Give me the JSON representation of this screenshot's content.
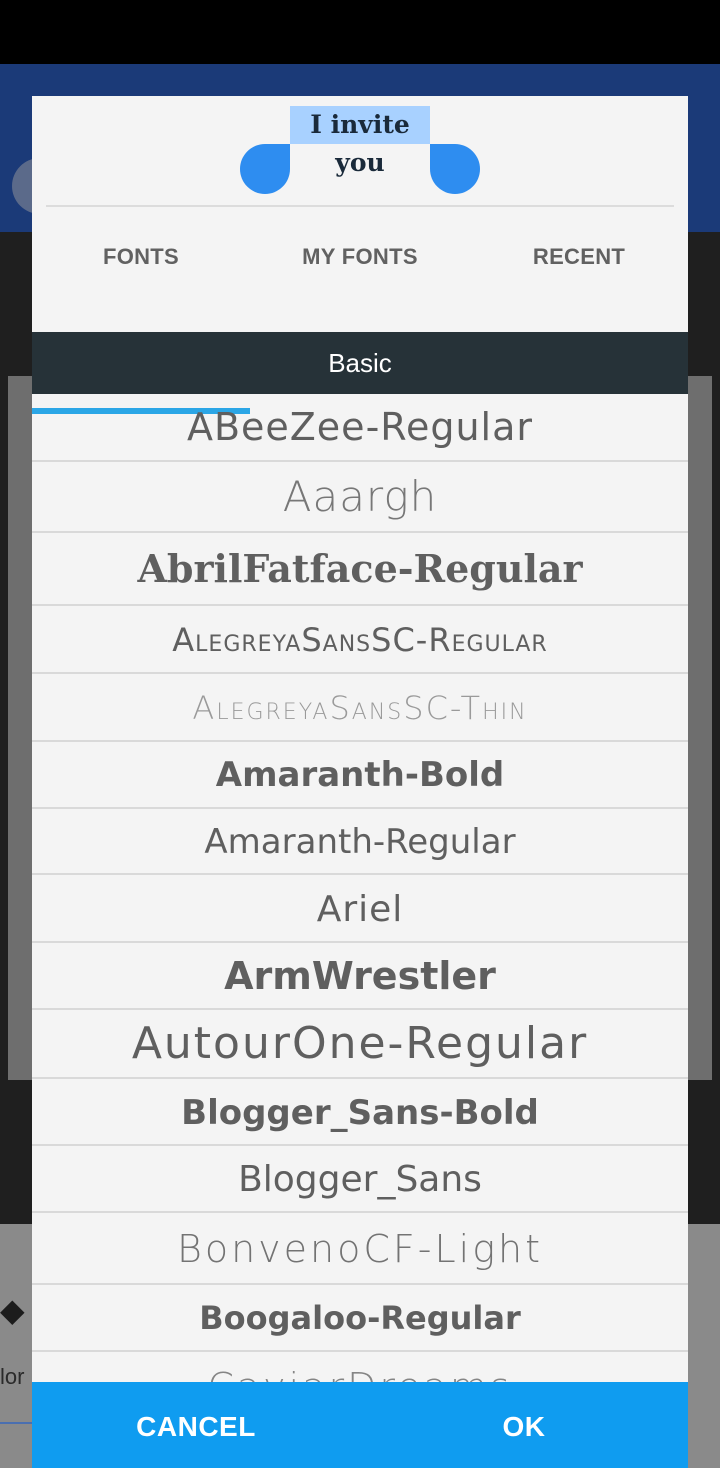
{
  "preview": {
    "text": "I invite you"
  },
  "tabs": [
    {
      "label": "FONTS",
      "selected": true
    },
    {
      "label": "MY FONTS",
      "selected": false
    },
    {
      "label": "RECENT",
      "selected": false
    }
  ],
  "section": {
    "title": "Basic"
  },
  "fonts": [
    "ABeeZee-Regular",
    "Aaargh",
    "AbrilFatface-Regular",
    "AlegreyaSansSC-Regular",
    "AlegreyaSansSC-Thin",
    "Amaranth-Bold",
    "Amaranth-Regular",
    "Ariel",
    "ArmWrestler",
    "AutourOne-Regular",
    "Blogger_Sans-Bold",
    "Blogger_Sans",
    "BonvenoCF-Light",
    "Boogaloo-Regular",
    "CaviarDreams"
  ],
  "actions": {
    "cancel_label": "CANCEL",
    "ok_label": "OK"
  },
  "colors": {
    "accent": "#0f9cf0",
    "tab_indicator": "#2ba6e6",
    "section_header_bg": "#263238",
    "selection_handle": "#2e8df0",
    "text_selection": "#a8d1ff"
  },
  "background": {
    "tool_label": "lor"
  }
}
